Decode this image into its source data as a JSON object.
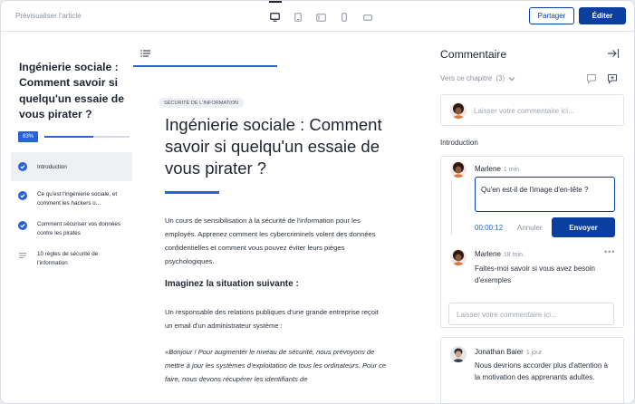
{
  "topbar": {
    "preview_title": "Prévisualiser l'article",
    "share_label": "Partager",
    "edit_label": "Éditer"
  },
  "nav": {
    "course_title": "Ingénierie sociale : Comment savoir si quelqu'un essaie de vous pirater ?",
    "progress_label": "83%",
    "progress": 0.57,
    "items": [
      {
        "label": "Introduction",
        "status": "completed"
      },
      {
        "label": "Ce qu'est l'ingénierie sociale, et comment les hackers o...",
        "status": "completed"
      },
      {
        "label": "Comment sécuriser vos données contre les pirates",
        "status": "completed"
      },
      {
        "label": "10 règles de sécurité de l'information",
        "status": "text"
      }
    ]
  },
  "article": {
    "tag": "SÉCURITÉ DE L'INFORMATION",
    "title": "Ingénierie sociale : Comment savoir si quelqu'un essaie de vous pirater ?",
    "intro": "Un cours de sensibilisation à la sécurité de l'information pour les employés. Apprenez comment les cybercriminels volent des données confidentielles et comment vous pouvez éviter leurs pièges psychologiques.",
    "subhead": "Imaginez la situation suivante :",
    "para2": "Un responsable des relations publiques d'une grande entreprise reçoit un email d'un administrateur système :",
    "quote": "«Bonjour ! Pour augmenter le niveau de sécurité, nous prévoyons de mettre à jour les systèmes d'exploitation de tous les ordinateurs. Pour ce faire, nous devons récupérer les identifiants de"
  },
  "comments": {
    "panel_title": "Commentaire",
    "chapter_select": "Vers ce chapitre",
    "chapter_count": "(3)",
    "new_placeholder": "Laisser votre commentaire ici...",
    "section_label": "Introduction",
    "thread": {
      "author": "Marlene",
      "time": "1 min.",
      "reply_value": "Qu'en est-il de l'image d'en-tête ?",
      "timer": "00:00:12",
      "cancel_label": "Annuler",
      "send_label": "Envoyer",
      "reply_author": "Marlene",
      "reply_time": "18 min.",
      "reply_text": "Faites-moi savoir si vous avez besoin d'exemples",
      "inner_placeholder": "Laisser votre commentaire ici..."
    },
    "second": {
      "author": "Jonathan Baier",
      "time": "1 jour",
      "text": "Nous devrions accorder plus d'attention à la motivation des apprenants adultes."
    }
  },
  "colors": {
    "accent": "#0a3e9f",
    "progress_blue": "#2563d6"
  }
}
